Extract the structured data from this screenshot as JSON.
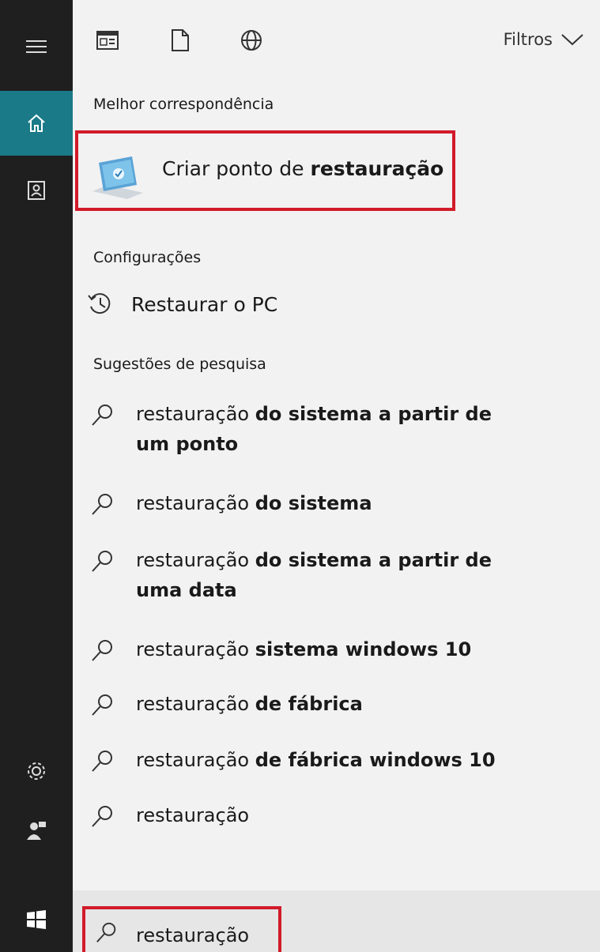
{
  "topbar": {
    "icons": [
      "apps-icon",
      "document-icon",
      "web-icon"
    ],
    "filters_label": "Filtros"
  },
  "rail": {
    "items": [
      "hamburger-menu-icon",
      "home-icon",
      "notebook-icon",
      "settings-icon",
      "feedback-icon",
      "windows-start-icon"
    ],
    "active": "home-icon",
    "accent_color": "#1b7a88"
  },
  "best_match": {
    "heading": "Melhor correspondência",
    "prefix": "Criar ponto de ",
    "bold": "restauração",
    "icon": "system-restore-icon"
  },
  "settings": {
    "heading": "Configurações",
    "item_label": "Restaurar o PC",
    "item_icon": "history-icon"
  },
  "suggestions": {
    "heading": "Sugestões de pesquisa",
    "items": [
      {
        "prefix": "restauração ",
        "bold": "do sistema a partir de um ponto"
      },
      {
        "prefix": "restauração ",
        "bold": "do sistema"
      },
      {
        "prefix": "restauração ",
        "bold": "do sistema a partir de uma data"
      },
      {
        "prefix": "restauração ",
        "bold": "sistema windows 10"
      },
      {
        "prefix": "restauração ",
        "bold": "de fábrica"
      },
      {
        "prefix": "restauração ",
        "bold": "de fábrica windows 10"
      },
      {
        "prefix": "restauração",
        "bold": ""
      }
    ]
  },
  "search": {
    "value": "restauração",
    "highlight_color": "#d11b2a"
  }
}
